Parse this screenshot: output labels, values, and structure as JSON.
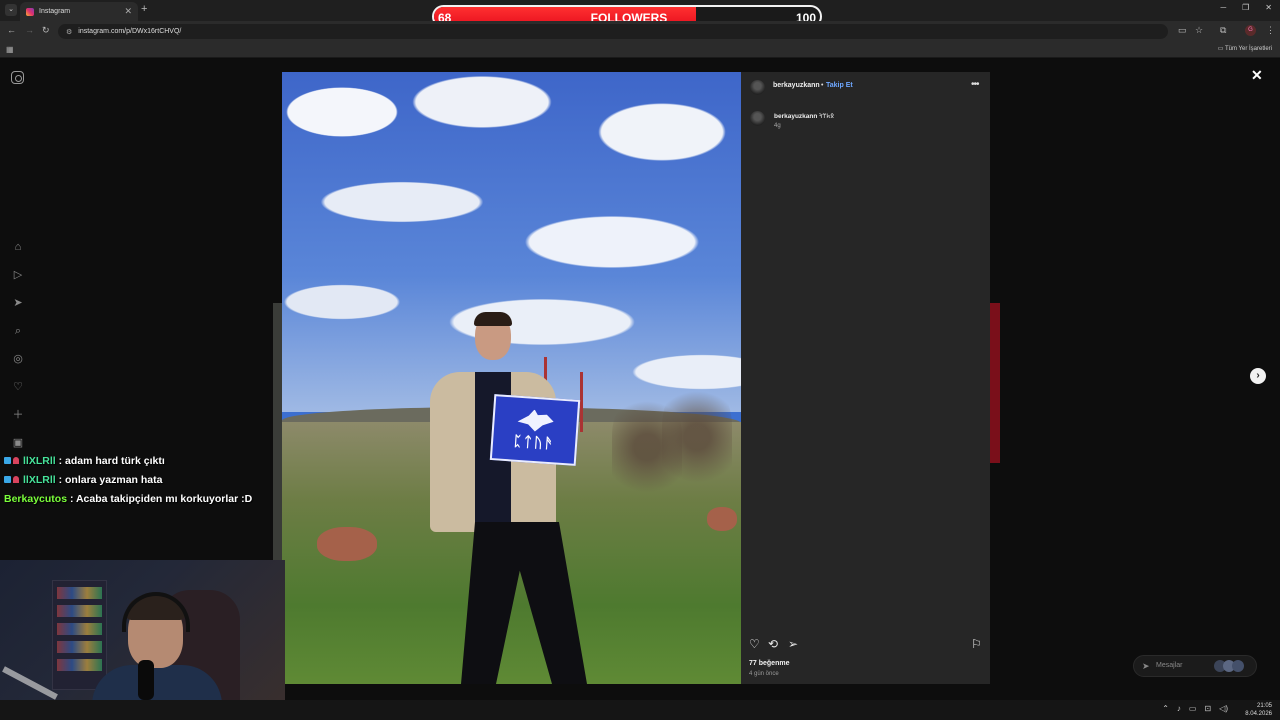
{
  "browser": {
    "tab_title": "Instagram",
    "tab_close": "✕",
    "new_tab": "+",
    "url": "instagram.com/p/DWx16rtCHVQ/",
    "bookmarks_all": "Tüm Yer İşaretleri",
    "profile_initial": "G",
    "window_controls": {
      "minimize": "─",
      "restore": "❐",
      "close": "✕"
    }
  },
  "followers_widget": {
    "current": "68",
    "label": "FOLLOWERS",
    "goal": "100",
    "progress": 0.68,
    "fill_color": "#e8101e"
  },
  "chat": [
    {
      "user": "llXLRll",
      "message": ": adam hard türk çıktı",
      "badges": true,
      "user_color": "#46e39a"
    },
    {
      "user": "llXLRll",
      "message": ": onlara yazman hata",
      "badges": true,
      "user_color": "#46e39a"
    },
    {
      "user": "Berkaycutos",
      "message": ": Acaba takipçiden mı korkuyorlar :D",
      "badges": false,
      "user_color": "#7bff3b"
    }
  ],
  "post": {
    "username": "berkayuzkann",
    "separator": "•",
    "follow_label": "Takip Et",
    "more_icon": "•••",
    "caption_user": "berkayuzkann",
    "caption_text": "𐰋𐱅𐰼𐰚",
    "caption_age": "4g",
    "sign_text": "ᛈᛏᚢᚫ",
    "likes": "77 beğenme",
    "posted": "4 gün önce"
  },
  "messages": {
    "label": "Mesajlar"
  },
  "sidebar_icons": [
    "home-icon",
    "reels-icon",
    "send-icon",
    "search-icon",
    "explore-icon",
    "heart-icon",
    "create-icon",
    "dashboard-icon"
  ],
  "taskbar": {
    "time": "21:05",
    "date": "8.04.2026"
  }
}
